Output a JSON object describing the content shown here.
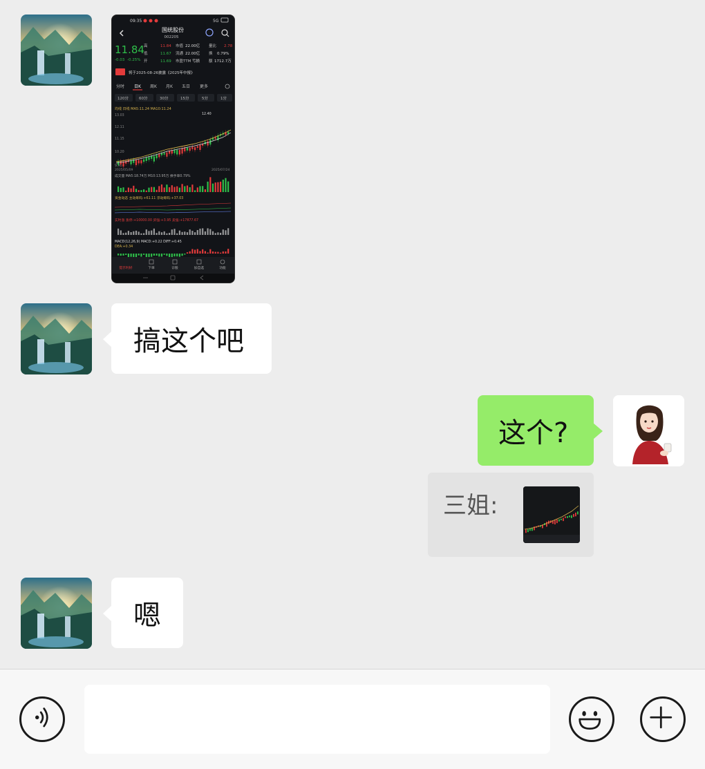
{
  "messages": [
    {
      "side": "left",
      "type": "image",
      "content": "stock-screenshot"
    },
    {
      "side": "left",
      "type": "text",
      "text": "搞这个吧"
    },
    {
      "side": "right",
      "type": "text",
      "text": "这个?"
    },
    {
      "side": "right",
      "type": "quote",
      "sender": "三姐:",
      "content": "stock-screenshot-thumb"
    },
    {
      "side": "left",
      "type": "text",
      "text": "嗯"
    }
  ],
  "stock_screenshot": {
    "status_time": "09:35",
    "status_signal": "5G",
    "stock_name": "国统股份",
    "stock_code": "002205",
    "price": "11.84",
    "change": "-0.03",
    "change_pct": "-0.25%",
    "stats_row1": [
      "高",
      "11.84",
      "市值",
      "22.00亿",
      "量比",
      "2.78"
    ],
    "stats_row2": [
      "低",
      "11.67",
      "流通",
      "22.00亿",
      "换",
      "0.79%"
    ],
    "stats_row3": [
      "开",
      "11.69",
      "市盈TTM",
      "亏损",
      "额",
      "1712.7万"
    ],
    "notice": "将于2025-08-26披露《2025年中报》",
    "period_tabs": [
      "分时",
      "日K",
      "周K",
      "月K",
      "五日",
      "更多"
    ],
    "active_period": "日K",
    "minute_tabs": [
      "120分",
      "60分",
      "30分",
      "15分",
      "5分",
      "1分"
    ],
    "ma_label": "均线 日线 MA5:11.24 MA10:11.24",
    "price_levels": [
      "13.03",
      "12.11",
      "11.15",
      "10.20",
      "9.45"
    ],
    "date_start": "2025/05/09",
    "date_end": "2025/07/24",
    "price_marker": "12.40",
    "volume_label": "成交量 MA5:18.74万 M10:13.95万 换手率0.79%",
    "indicator1_label": "资金动态 主动筹码:+61.11 浮动筹码:+37.03",
    "indicator2_label": "实时涨 涨停:+10000.00 买强:+3.95 卖强:+17877.67",
    "macd_label": "MACD(12,26,9) MACD:+0.22 DIFF:+0.45",
    "dea_label": "DEA:+0.34",
    "bottom_nav": [
      "提示利好",
      "下单",
      "诊股",
      "加自选",
      "功能"
    ]
  },
  "input_bar": {
    "voice_icon": "voice-icon",
    "emoji_icon": "emoji-icon",
    "plus_icon": "plus-icon",
    "input_value": ""
  },
  "colors": {
    "background": "#ededed",
    "green_bubble": "#95ec69",
    "white_bubble": "#ffffff",
    "quote_bg": "#e3e3e3",
    "stock_up": "#e33b3b",
    "stock_down": "#2fbf4a"
  }
}
